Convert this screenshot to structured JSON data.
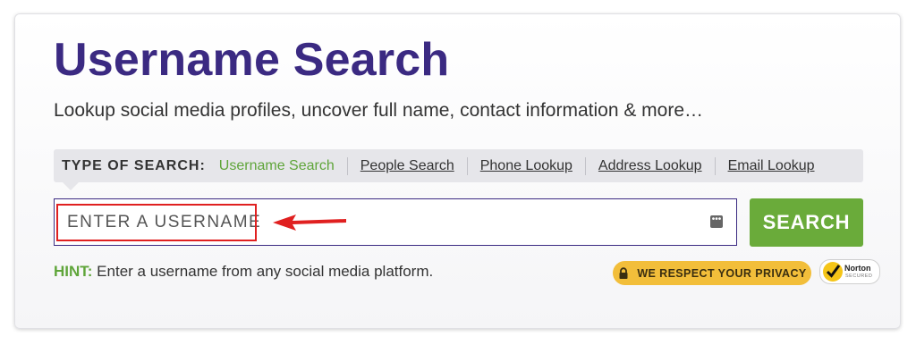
{
  "page": {
    "title": "Username Search",
    "subtitle": "Lookup social media profiles, uncover full name, contact information & more…"
  },
  "search_types": {
    "label": "TYPE OF SEARCH:",
    "items": [
      {
        "label": "Username Search",
        "active": true
      },
      {
        "label": "People Search",
        "active": false
      },
      {
        "label": "Phone Lookup",
        "active": false
      },
      {
        "label": "Address Lookup",
        "active": false
      },
      {
        "label": "Email Lookup",
        "active": false
      }
    ]
  },
  "search": {
    "placeholder": "ENTER A USERNAME",
    "value": "",
    "button_label": "SEARCH"
  },
  "hint": {
    "label": "HINT:",
    "text": " Enter a username from any social media platform."
  },
  "badges": {
    "privacy": "WE RESPECT YOUR PRIVACY",
    "norton": "Norton",
    "norton_sub": "SECURED"
  },
  "colors": {
    "title": "#3b2a82",
    "accent_green": "#6aab3a",
    "privacy_badge": "#f2be3a",
    "annotation_red": "#e02020"
  },
  "icons": [
    "lock-icon",
    "keyboard-dots-icon",
    "norton-check-icon",
    "red-arrow-annotation"
  ]
}
